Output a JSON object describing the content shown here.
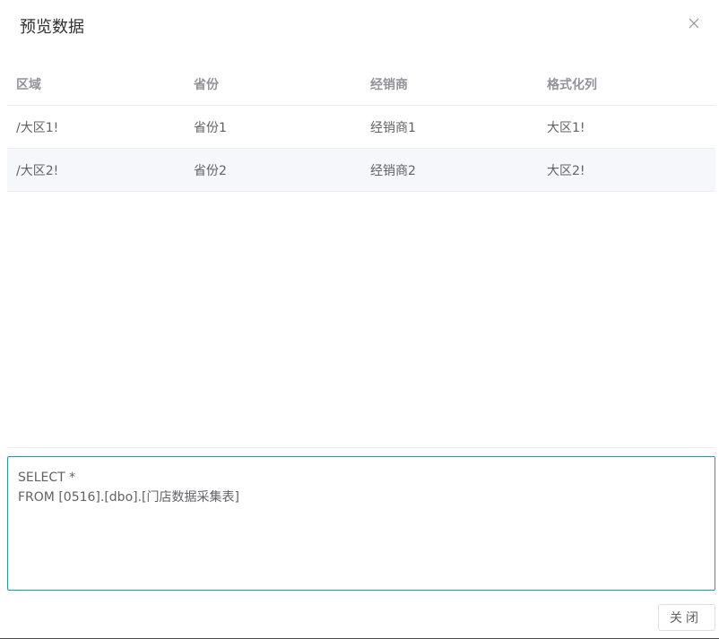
{
  "dialog": {
    "title": "预览数据",
    "close_icon": "close-icon"
  },
  "table": {
    "columns": [
      "区域",
      "省份",
      "经销商",
      "格式化列"
    ],
    "rows": [
      [
        "/大区1!",
        "省份1",
        "经销商1",
        "大区1!"
      ],
      [
        "/大区2!",
        "省份2",
        "经销商2",
        "大区2!"
      ]
    ]
  },
  "sql": {
    "line1": "SELECT *",
    "line2": "FROM [0516].[dbo].[门店数据采集表]"
  },
  "footer": {
    "close_label": "关闭"
  },
  "colors": {
    "accent_border": "#1a9bb6",
    "stripe": "#f5f7fa"
  }
}
